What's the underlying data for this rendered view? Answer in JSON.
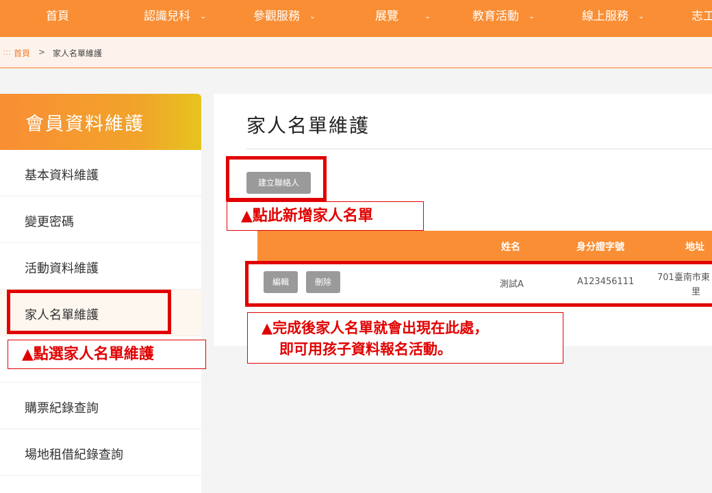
{
  "nav": {
    "items": [
      {
        "label": "首頁"
      },
      {
        "label": "認識兒科"
      },
      {
        "label": "參觀服務"
      },
      {
        "label": "展覽"
      },
      {
        "label": "教育活動"
      },
      {
        "label": "線上服務"
      },
      {
        "label": "志工"
      }
    ]
  },
  "breadcrumb": {
    "prefix": ":::",
    "home": "首頁",
    "separator": ">",
    "current": "家人名單維護"
  },
  "sidebar": {
    "title": "會員資料維護",
    "items": [
      {
        "label": "基本資料維護"
      },
      {
        "label": "變更密碼"
      },
      {
        "label": "活動資料維護"
      },
      {
        "label": "家人名單維護"
      },
      {
        "label": "購票紀錄查詢"
      },
      {
        "label": "場地租借紀錄查詢"
      }
    ]
  },
  "main": {
    "title": "家人名單維護",
    "create_button": "建立聯絡人",
    "table": {
      "headers": [
        "姓名",
        "身分證字號",
        "地址"
      ],
      "rows": [
        {
          "edit": "編輯",
          "delete": "刪除",
          "name": "測試A",
          "id": "A123456111",
          "address_line1": "701臺南市東",
          "address_line2": "里"
        }
      ]
    }
  },
  "annotations": {
    "create": "▲點此新增家人名單",
    "sidebar": "▲點選家人名單維護",
    "result_line1": "▲完成後家人名單就會出現在此處，",
    "result_line2": "即可用孩子資料報名活動。"
  },
  "colors": {
    "brand_orange": "#f98e34",
    "annotation_red": "#e10000",
    "button_gray": "#9a9a9a"
  },
  "icons": {
    "nav_dropdown": "chevron-down-icon"
  }
}
